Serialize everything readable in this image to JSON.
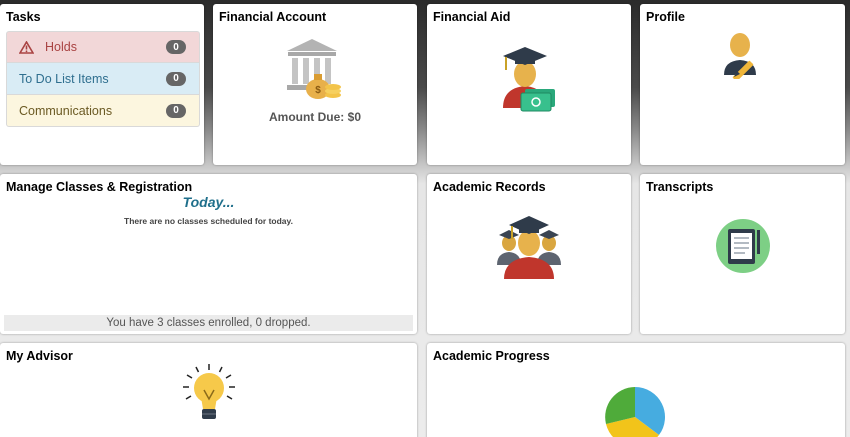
{
  "tasks": {
    "title": "Tasks",
    "items": [
      {
        "label": "Holds",
        "count": "0"
      },
      {
        "label": "To Do List Items",
        "count": "0"
      },
      {
        "label": "Communications",
        "count": "0"
      }
    ]
  },
  "financial_account": {
    "title": "Financial Account",
    "amount_due": "Amount Due: $0",
    "icon": "bank-money-icon"
  },
  "financial_aid": {
    "title": "Financial Aid",
    "icon": "graduate-money-icon"
  },
  "profile": {
    "title": "Profile",
    "icon": "user-edit-icon"
  },
  "manage_classes": {
    "title": "Manage Classes & Registration",
    "today": "Today...",
    "no_classes": "There are no classes scheduled for today.",
    "enrolled": "You have 3 classes enrolled,  0 dropped."
  },
  "academic_records": {
    "title": "Academic Records",
    "icon": "graduates-group-icon"
  },
  "transcripts": {
    "title": "Transcripts",
    "icon": "tablet-document-icon"
  },
  "my_advisor": {
    "title": "My Advisor",
    "icon": "lightbulb-icon"
  },
  "academic_progress": {
    "title": "Academic Progress",
    "icon": "pie-chart-icon"
  },
  "colors": {
    "holds": "#a94342",
    "todo": "#2f6f8f",
    "today": "#1f6f8b",
    "badge": "#666666"
  }
}
